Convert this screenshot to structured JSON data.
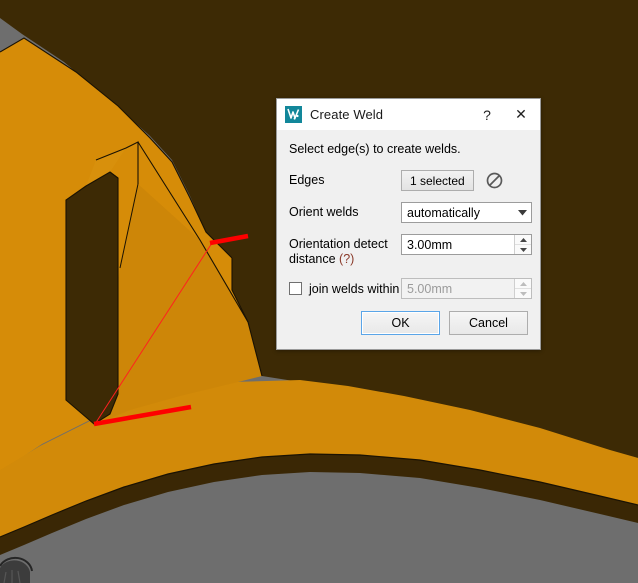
{
  "viewport": {
    "name": "cad-3d-viewport",
    "colors": {
      "background_gray": "#6e6e6e",
      "part_orange_lit": "#d68c08",
      "part_orange_mid": "#c98207",
      "part_brown_shade": "#3d2a05",
      "part_brown_dark": "#392705",
      "edge_line": "#1a1203",
      "selection_red": "#fe0000",
      "hairline_red": "#ff1414",
      "bolt_dark": "#3a3a3a"
    }
  },
  "dialog": {
    "titlebar": {
      "app_icon": "weld-app-icon",
      "title": "Create Weld",
      "help_label": "?",
      "close_label": "✕"
    },
    "instruction": "Select edge(s) to create welds.",
    "fields": {
      "edges": {
        "label": "Edges",
        "button_label": "1 selected",
        "clear_icon": "no-selection-icon"
      },
      "orient_welds": {
        "label": "Orient welds",
        "value": "automatically",
        "options": [
          "automatically"
        ]
      },
      "orientation_distance": {
        "label_line1": "Orientation detect",
        "label_line2": "distance ",
        "label_hint": "(?)",
        "value": "3.00mm"
      },
      "join_welds": {
        "checked": false,
        "label": "join welds within",
        "value": "5.00mm",
        "disabled": true
      }
    },
    "footer": {
      "ok_label": "OK",
      "cancel_label": "Cancel"
    }
  }
}
